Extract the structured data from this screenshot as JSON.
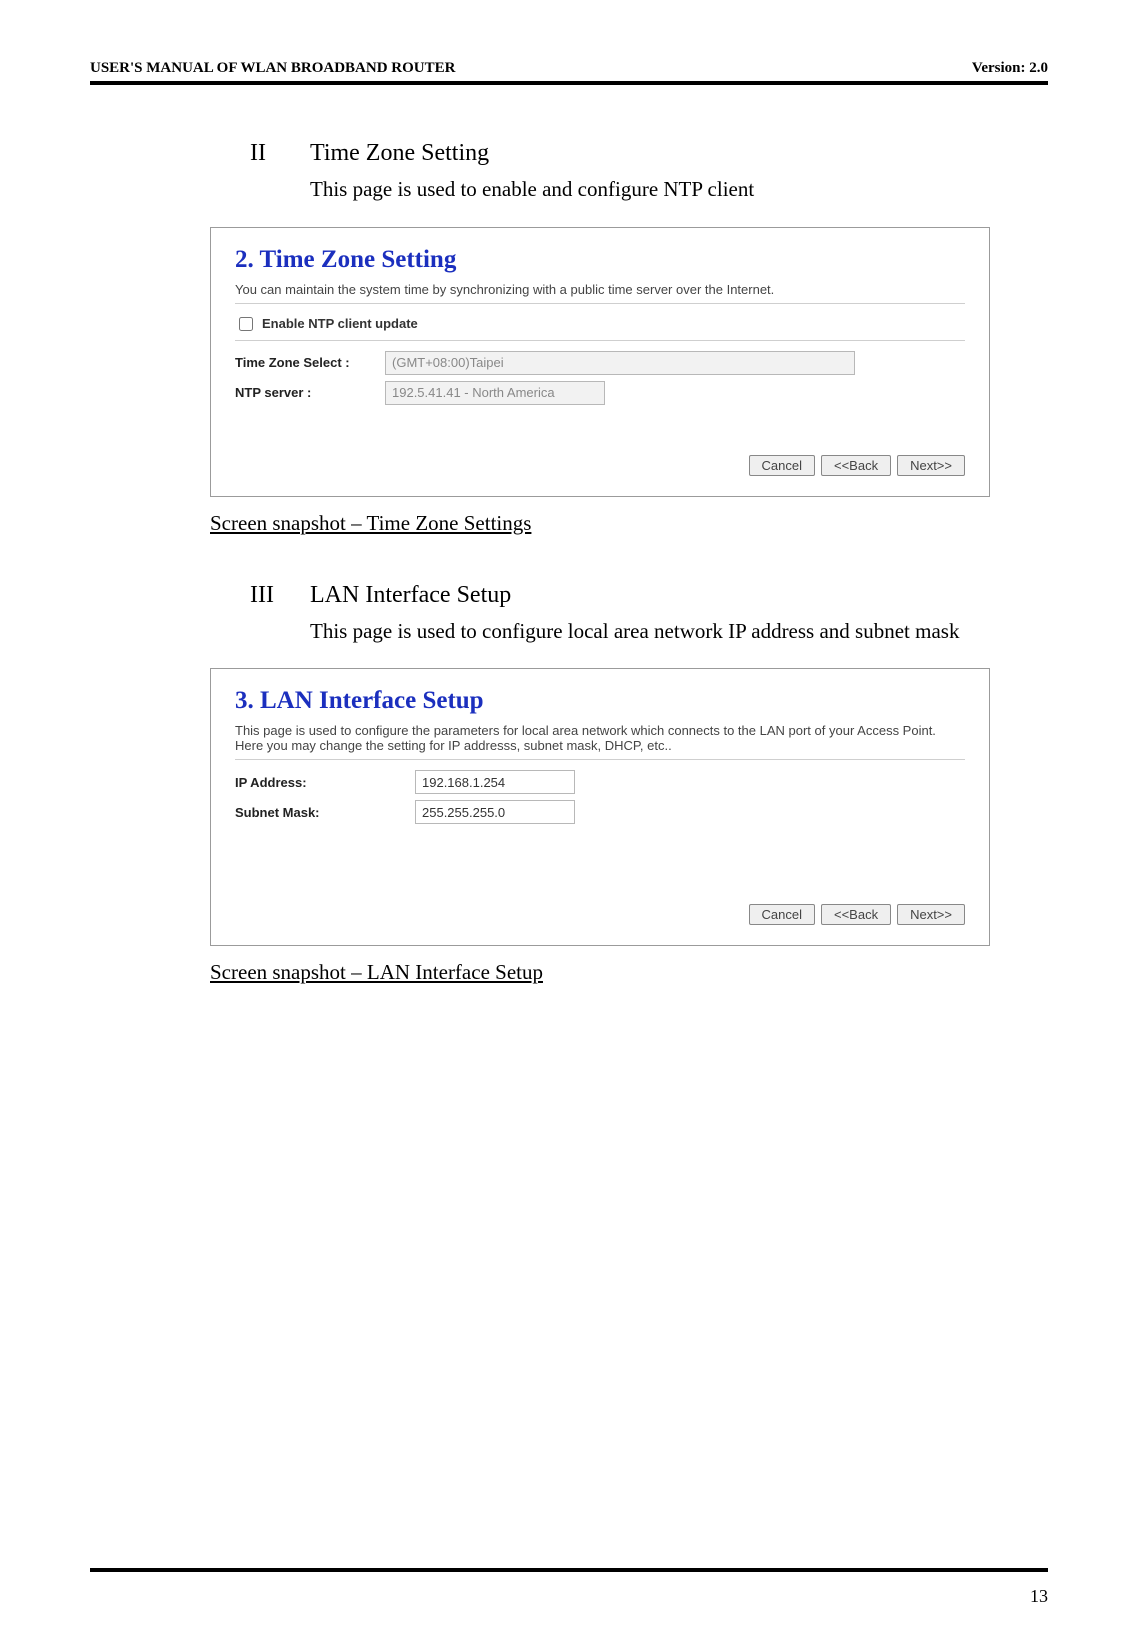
{
  "header": {
    "left": "USER'S MANUAL OF WLAN BROADBAND ROUTER",
    "right": "Version: 2.0"
  },
  "section2": {
    "roman": "II",
    "title": "Time Zone Setting",
    "desc": "This page is used to enable and configure NTP client"
  },
  "shot1": {
    "title": "2. Time Zone Setting",
    "intro": "You can maintain the system time by synchronizing with a public time server over the Internet.",
    "enable_label": "Enable NTP client update",
    "tz_label": "Time Zone Select :",
    "tz_value": "(GMT+08:00)Taipei",
    "ntp_label": "NTP server :",
    "ntp_value": "192.5.41.41 - North America",
    "btn_cancel": "Cancel",
    "btn_back": "<<Back",
    "btn_next": "Next>>"
  },
  "caption1": "Screen snapshot – Time Zone Settings",
  "section3": {
    "roman": "III",
    "title": "LAN Interface Setup",
    "desc": "This page is used to configure local area network IP address and subnet mask"
  },
  "shot2": {
    "title": "3. LAN Interface Setup",
    "intro": "This page is used to configure the parameters for local area network which connects to the LAN port of your Access Point. Here you may change the setting for IP addresss, subnet mask, DHCP, etc..",
    "ip_label": "IP Address:",
    "ip_value": "192.168.1.254",
    "mask_label": "Subnet Mask:",
    "mask_value": "255.255.255.0",
    "btn_cancel": "Cancel",
    "btn_back": "<<Back",
    "btn_next": "Next>>"
  },
  "caption2": "Screen snapshot – LAN Interface Setup",
  "page_number": "13"
}
